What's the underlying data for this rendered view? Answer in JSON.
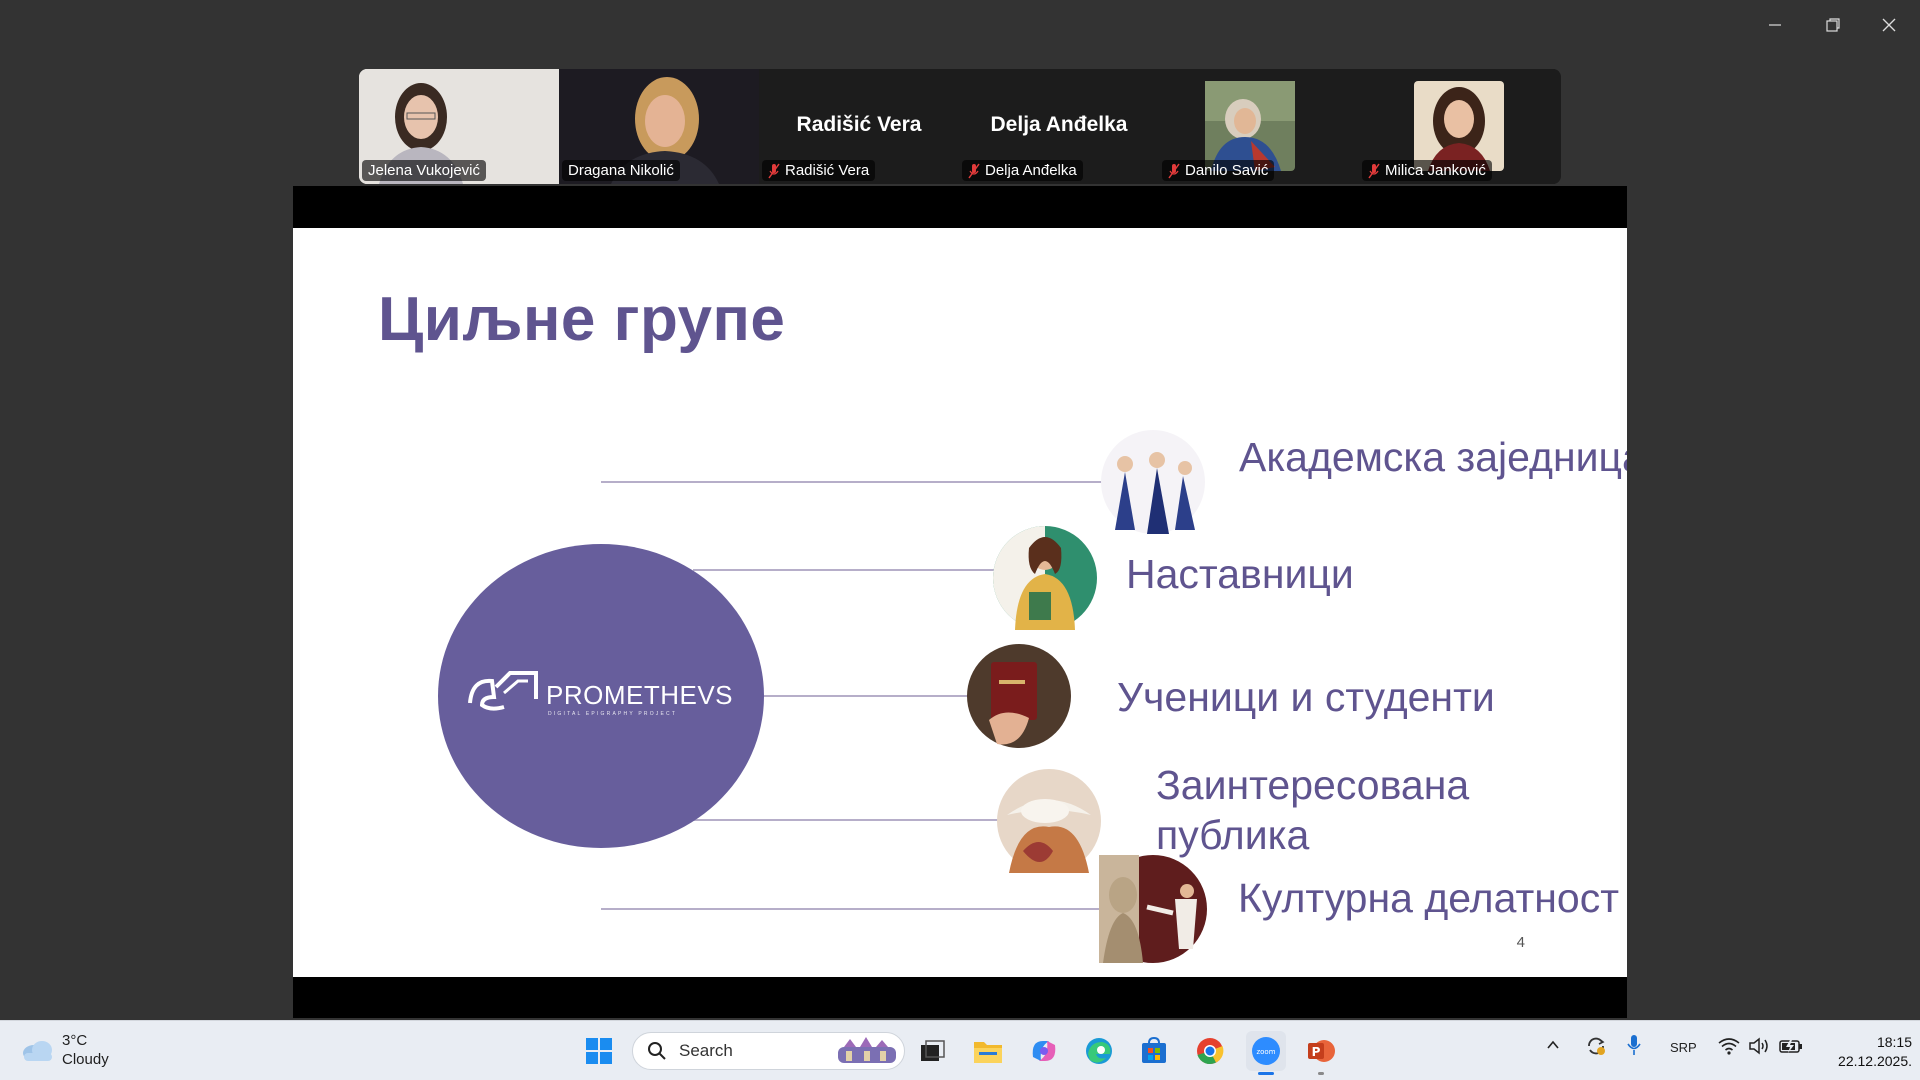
{
  "window": {
    "minimize_icon": "minimize-icon",
    "restore_icon": "restore-icon",
    "close_icon": "close-icon"
  },
  "participants": [
    {
      "name": "Jelena Vukojević",
      "video": true,
      "muted": false,
      "active": false
    },
    {
      "name": "Dragana Nikolić",
      "video": true,
      "muted": false,
      "active": true
    },
    {
      "name": "Radišić Vera",
      "video": false,
      "muted": true,
      "active": false
    },
    {
      "name": "Delja Anđelka",
      "video": false,
      "muted": true,
      "active": false
    },
    {
      "name": "Danilo Savić",
      "video": false,
      "muted": true,
      "active": false
    },
    {
      "name": "Milica Janković",
      "video": false,
      "muted": true,
      "active": false
    }
  ],
  "slide": {
    "title": "Циљне групе",
    "logo_text": "PROMETHEVS",
    "logo_subtext": "DIGITAL EPIGRAPHY PROJECT",
    "groups": [
      "Академска заједница",
      "Наставници",
      "Ученици и студенти",
      "Заинтересована публика",
      "Културна делатност"
    ],
    "page_number": "4",
    "accent_color": "#675e9c",
    "title_color": "#5f548f"
  },
  "taskbar": {
    "weather_temp": "3°C",
    "weather_desc": "Cloudy",
    "search_placeholder": "Search",
    "language": "SRP",
    "time": "18:15",
    "date": "22.12.2025.",
    "apps": [
      "start",
      "search",
      "task-view",
      "file-explorer",
      "copilot",
      "edge",
      "store",
      "chrome",
      "zoom",
      "powerpoint"
    ]
  }
}
